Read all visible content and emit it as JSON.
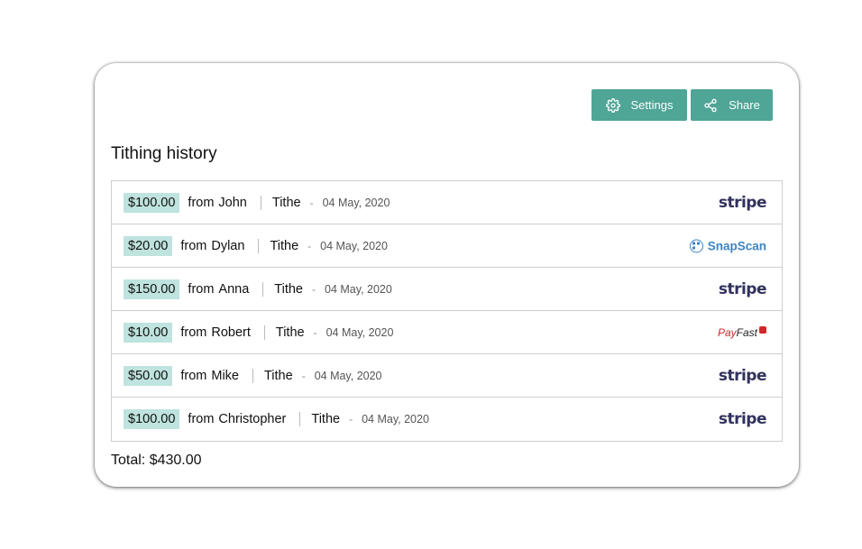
{
  "toolbar": {
    "settings_label": "Settings",
    "share_label": "Share",
    "accent_color": "#4fa596"
  },
  "page_title": "Tithing history",
  "rows": [
    {
      "amount": "$100.00",
      "from_word": "from",
      "name": "John",
      "type": "Tithe",
      "dash": "-",
      "date": "04 May, 2020",
      "provider": "stripe"
    },
    {
      "amount": "$20.00",
      "from_word": "from",
      "name": "Dylan",
      "type": "Tithe",
      "dash": "-",
      "date": "04 May, 2020",
      "provider": "SnapScan"
    },
    {
      "amount": "$150.00",
      "from_word": "from",
      "name": "Anna",
      "type": "Tithe",
      "dash": "-",
      "date": "04 May, 2020",
      "provider": "stripe"
    },
    {
      "amount": "$10.00",
      "from_word": "from",
      "name": "Robert",
      "type": "Tithe",
      "dash": "-",
      "date": "04 May, 2020",
      "provider": "PayFast"
    },
    {
      "amount": "$50.00",
      "from_word": "from",
      "name": "Mike",
      "type": "Tithe",
      "dash": "-",
      "date": "04 May, 2020",
      "provider": "stripe"
    },
    {
      "amount": "$100.00",
      "from_word": "from",
      "name": "Christopher",
      "type": "Tithe",
      "dash": "-",
      "date": "04 May, 2020",
      "provider": "stripe"
    }
  ],
  "provider_logos": {
    "stripe": {
      "text": "stripe",
      "color": "#32325d"
    },
    "snapscan": {
      "text": "SnapScan",
      "color": "#3c85c5"
    },
    "payfast": {
      "pay": "Pay",
      "fast": "Fast",
      "color": "#d0272b"
    }
  },
  "total_text": "Total: $430.00",
  "amount_highlight_color": "#bfe3de"
}
